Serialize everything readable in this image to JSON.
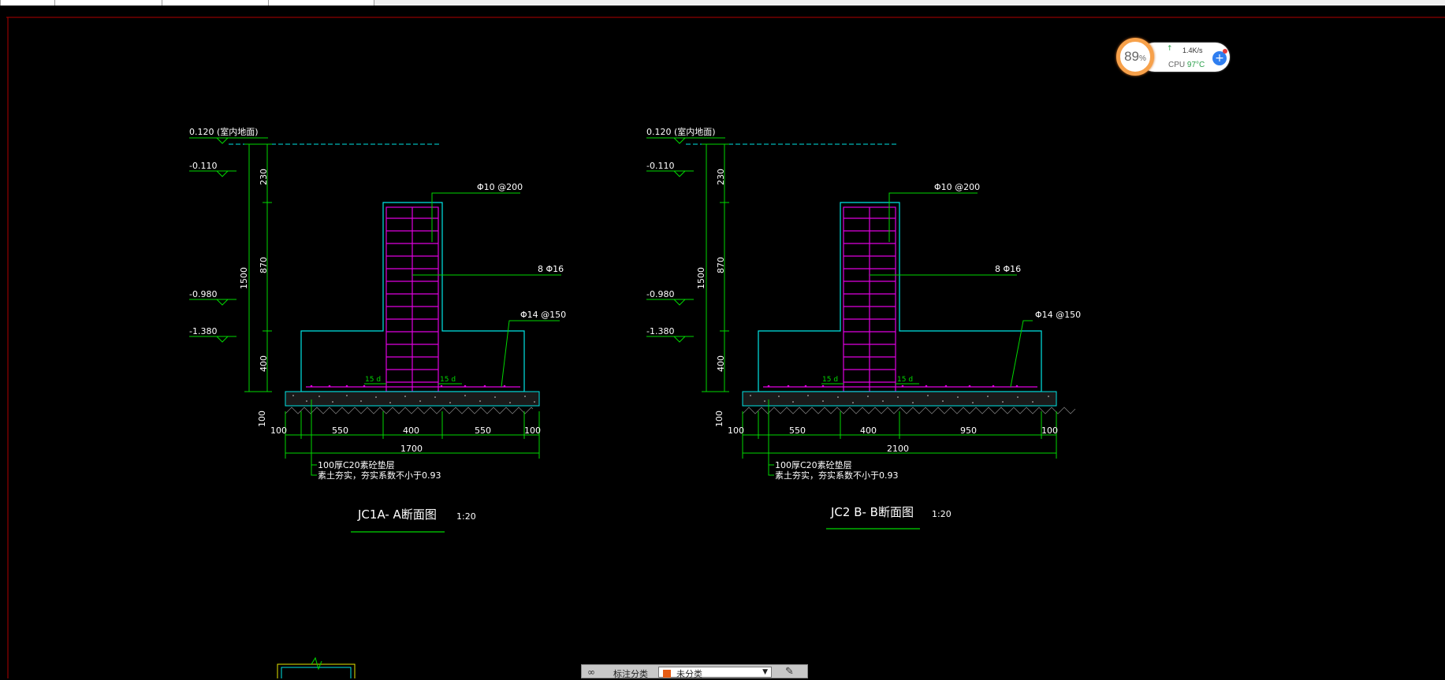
{
  "colors": {
    "background": "#000000",
    "concrete_outline": "#00e5e5",
    "rebar": "#e000e0",
    "dimension": "#00d800",
    "text": "#ffffff",
    "frame_line": "#b00000"
  },
  "drawings": [
    {
      "title": "JC1A- A断面图",
      "scale": "1:20",
      "levels": [
        "0.120 (室内地面)",
        "-0.110",
        "-0.980",
        "-1.380"
      ],
      "vertical_dims": [
        "230",
        "870",
        "400",
        "1500",
        "100"
      ],
      "rebar_labels": [
        "Φ10 @200",
        "8 Φ16",
        "Φ14 @150"
      ],
      "anchorage_labels": [
        "15 d",
        "15 d"
      ],
      "bottom_dims": [
        "100",
        "550",
        "400",
        "550",
        "100"
      ],
      "total_width": "1700",
      "notes": [
        "100厚C20素砼垫层",
        "素土夯实，夯实系数不小于0.93"
      ]
    },
    {
      "title": "JC2 B- B断面图",
      "scale": "1:20",
      "levels": [
        "0.120 (室内地面)",
        "-0.110",
        "-0.980",
        "-1.380"
      ],
      "vertical_dims": [
        "230",
        "870",
        "400",
        "1500",
        "100"
      ],
      "rebar_labels": [
        "Φ10 @200",
        "8 Φ16",
        "Φ14 @150"
      ],
      "anchorage_labels": [
        "15 d",
        "15 d"
      ],
      "bottom_dims": [
        "100",
        "550",
        "400",
        "950",
        "100"
      ],
      "total_width": "2100",
      "notes": [
        "100厚C20素砼垫层",
        "素土夯实，夯实系数不小于0.93"
      ]
    }
  ],
  "perf_widget": {
    "percent": "89",
    "percent_unit": "%",
    "net_speed": "1.4K/s",
    "cpu_label": "CPU",
    "cpu_temp": "97°C",
    "boost_icon": "plus-icon"
  },
  "annotation_toolbar": {
    "label": "标注分类",
    "selected": "未分类",
    "icons": [
      "infinity-icon",
      "chevron-down-icon",
      "pencil-icon"
    ]
  }
}
